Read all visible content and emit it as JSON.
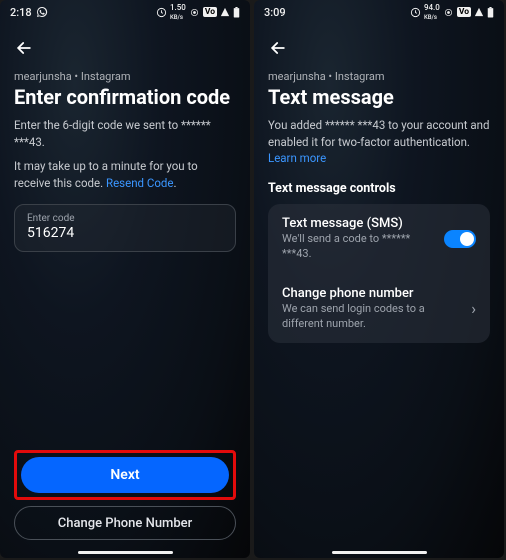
{
  "left": {
    "statusbar": {
      "time": "2:18",
      "battery_icons_alt": "status-icons"
    },
    "breadcrumb": "mearjunsha • Instagram",
    "title": "Enter confirmation code",
    "subtext1": "Enter the 6-digit code we sent to ****** ***43.",
    "subtext2_pre": "It may take up to a minute for you to receive this code. ",
    "resend_link": "Resend Code",
    "input_label": "Enter code",
    "input_value": "516274",
    "btn_next": "Next",
    "btn_change": "Change Phone Number"
  },
  "right": {
    "statusbar": {
      "time": "3:09"
    },
    "breadcrumb": "mearjunsha • Instagram",
    "title": "Text message",
    "subtext_pre": "You added ****** ***43 to your account and enabled it for two-factor authentication. ",
    "learn_more": "Learn more",
    "section_title": "Text message controls",
    "rows": [
      {
        "title": "Text message (SMS)",
        "sub": "We'll send a code to ****** ***43."
      },
      {
        "title": "Change phone number",
        "sub": "We can send login codes to a different number."
      }
    ]
  }
}
